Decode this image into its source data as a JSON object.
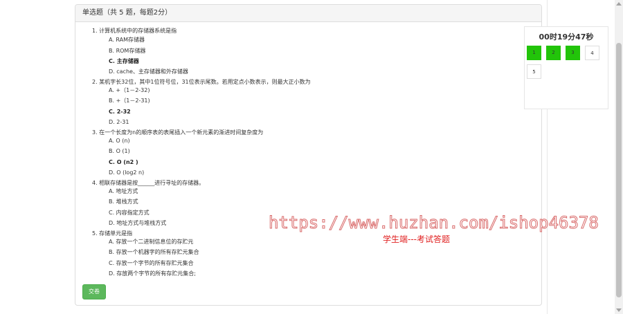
{
  "panel": {
    "heading": "单选题（共 5 题，每题2分）"
  },
  "questions": [
    {
      "title": "1. 计算机系统中的存储器系统是指",
      "options": [
        "A. RAM存储器",
        "B. ROM存储器",
        "C. 主存储器",
        "D. cache、主存储器和外存储器"
      ],
      "selected": 2
    },
    {
      "title": "2. 某机字长32位，其中1位符号位，31位表示尾数。若用定点小数表示，则最大正小数为",
      "options": [
        "A. +（1－2-32)",
        "B. +（1－2-31)",
        "C. 2-32",
        "D. 2-31"
      ],
      "selected": 2
    },
    {
      "title": "3. 在一个长度为n的顺序表的表尾插入一个新元素的渐进时间复杂度为",
      "options": [
        "A. O (n)",
        "B. O (1)",
        "C. O (n2 )",
        "D. O (log2 n)"
      ],
      "selected": 2
    },
    {
      "title": "4. 相联存储器是按______进行寻址的存储器。",
      "options": [
        "A. 地址方式",
        "B. 堆栈方式",
        "C. 内容指定方式",
        "D. 地址方式与堆栈方式"
      ],
      "selected": -1
    },
    {
      "title": "5. 存储单元是指",
      "options": [
        "A. 存放一个二进制信息位的存贮元",
        "B. 存放一个机器字的所有存贮元集合",
        "C. 存放一个字节的所有存贮元集合",
        "D. 存放两个字节的所有存贮元集合;"
      ],
      "selected": -1
    }
  ],
  "submit_label": "交卷",
  "timer": "00时19分47秒",
  "nav": [
    {
      "label": "1",
      "answered": true
    },
    {
      "label": "2",
      "answered": true
    },
    {
      "label": "3",
      "answered": true
    },
    {
      "label": "4",
      "answered": false
    },
    {
      "label": "5",
      "answered": false
    }
  ],
  "colors": {
    "answered": "#22c40a",
    "submit": "#5cb85c",
    "subtitle": "#e02020"
  },
  "watermark": "https://www.huzhan.com/ishop46378",
  "caption": "学生端---考试答题"
}
